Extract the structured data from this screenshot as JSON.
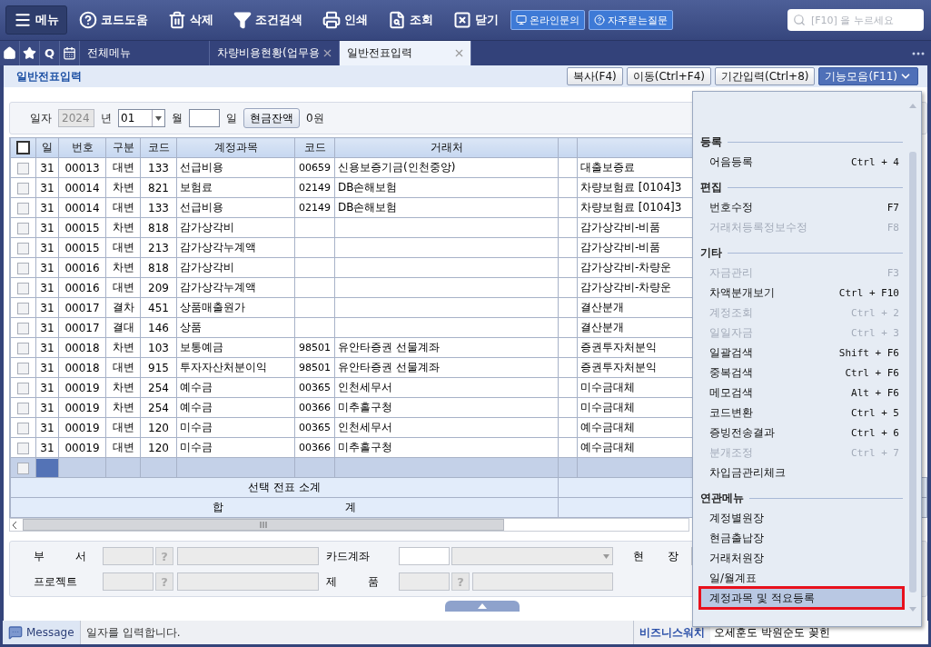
{
  "toolbar": {
    "buttons": [
      {
        "kind": "menu",
        "label": "메뉴"
      },
      {
        "kind": "help",
        "label": "코드도움"
      },
      {
        "kind": "delete",
        "label": "삭제"
      },
      {
        "kind": "filter",
        "label": "조건검색"
      },
      {
        "kind": "print",
        "label": "인쇄"
      },
      {
        "kind": "view",
        "label": "조회"
      },
      {
        "kind": "close",
        "label": "닫기"
      }
    ],
    "links": [
      {
        "kind": "monitor",
        "label": "온라인문의"
      },
      {
        "kind": "help",
        "label": "자주묻는질문"
      }
    ],
    "search": {
      "placeholder": "[F10] 을 누르세요"
    }
  },
  "tab_bar": {
    "quick": [
      {
        "kind": "home"
      },
      {
        "kind": "star"
      },
      {
        "kind": "text",
        "label": "Q"
      },
      {
        "kind": "calendar"
      }
    ],
    "tabs": [
      {
        "label": "전체메뉴",
        "selected": false,
        "closable": false
      },
      {
        "label": "차량비용현황(업무용",
        "selected": false,
        "closable": true
      },
      {
        "label": "일반전표입력",
        "selected": true,
        "closable": true
      }
    ]
  },
  "title_bar": {
    "title": "일반전표입력",
    "buttons": [
      {
        "label": "복사(F4)",
        "primary": false
      },
      {
        "label": "이동(Ctrl+F4)",
        "primary": false
      },
      {
        "label": "기간입력(Ctrl+8)",
        "primary": false
      },
      {
        "label": "기능모음(F11)",
        "primary": true
      }
    ]
  },
  "filter": {
    "date_label": "일자",
    "year": "2024",
    "year_unit": "년",
    "month": "01",
    "month_unit": "월",
    "day_unit": "일",
    "cash_button": "현금잔액",
    "cash_amount": "0원"
  },
  "table": {
    "header_checked": false,
    "columns": [
      "일",
      "번호",
      "구분",
      "코드",
      "계정과목",
      "코드",
      "거래처"
    ],
    "rows": [
      {
        "checked": false,
        "cells": [
          "31",
          "00013",
          "대변",
          "133",
          "선급비용",
          "00659",
          "신용보증기금(인천중앙)"
        ],
        "memo": "대출보증료"
      },
      {
        "checked": false,
        "cells": [
          "31",
          "00014",
          "차변",
          "821",
          "보험료",
          "02149",
          "DB손해보험"
        ],
        "memo": "차량보험료 [0104]3"
      },
      {
        "checked": false,
        "cells": [
          "31",
          "00014",
          "대변",
          "133",
          "선급비용",
          "02149",
          "DB손해보험"
        ],
        "memo": "차량보험료 [0104]3"
      },
      {
        "checked": false,
        "cells": [
          "31",
          "00015",
          "차변",
          "818",
          "감가상각비",
          "",
          ""
        ],
        "memo": "감가상각비-비품"
      },
      {
        "checked": false,
        "cells": [
          "31",
          "00015",
          "대변",
          "213",
          "감가상각누계액",
          "",
          ""
        ],
        "memo": "감가상각비-비품"
      },
      {
        "checked": false,
        "cells": [
          "31",
          "00016",
          "차변",
          "818",
          "감가상각비",
          "",
          ""
        ],
        "memo": "감가상각비-차량운"
      },
      {
        "checked": false,
        "cells": [
          "31",
          "00016",
          "대변",
          "209",
          "감가상각누계액",
          "",
          ""
        ],
        "memo": "감가상각비-차량운"
      },
      {
        "checked": false,
        "cells": [
          "31",
          "00017",
          "결차",
          "451",
          "상품매출원가",
          "",
          ""
        ],
        "memo": "결산분개"
      },
      {
        "checked": false,
        "cells": [
          "31",
          "00017",
          "결대",
          "146",
          "상품",
          "",
          ""
        ],
        "memo": "결산분개"
      },
      {
        "checked": false,
        "cells": [
          "31",
          "00018",
          "차변",
          "103",
          "보통예금",
          "98501",
          "유안타증권 선물계좌"
        ],
        "memo": "증권투자처분익"
      },
      {
        "checked": false,
        "cells": [
          "31",
          "00018",
          "대변",
          "915",
          "투자자산처분이익",
          "98501",
          "유안타증권 선물계좌"
        ],
        "memo": "증권투자처분익"
      },
      {
        "checked": false,
        "cells": [
          "31",
          "00019",
          "차변",
          "254",
          "예수금",
          "00365",
          "인천세무서"
        ],
        "memo": "미수금대체"
      },
      {
        "checked": false,
        "cells": [
          "31",
          "00019",
          "차변",
          "254",
          "예수금",
          "00366",
          "미추홀구청"
        ],
        "memo": "미수금대체"
      },
      {
        "checked": false,
        "cells": [
          "31",
          "00019",
          "대변",
          "120",
          "미수금",
          "00365",
          "인천세무서"
        ],
        "memo": "예수금대체"
      },
      {
        "checked": false,
        "cells": [
          "31",
          "00019",
          "대변",
          "120",
          "미수금",
          "00366",
          "미추홀구청"
        ],
        "memo": "예수금대체"
      }
    ],
    "entry_row": {
      "checked": false,
      "selected": true
    },
    "subtotal_label": "선택 전표 소계",
    "total_label": "합 계"
  },
  "detail_form": {
    "department": {
      "label": "부 서",
      "help": "?"
    },
    "project": {
      "label": "프로젝트",
      "help": "?"
    },
    "card_account": {
      "label": "카드계좌"
    },
    "product": {
      "label": "제 품",
      "help": "?"
    },
    "site": {
      "label": "현 장"
    }
  },
  "status_bar": {
    "message_label": "Message",
    "message": "일자를 입력합니다.",
    "news_source": "비즈니스워치",
    "news": "오세훈도 박원순도 꽂힌"
  },
  "function_menu": {
    "sections": [
      {
        "title": "등록",
        "items": [
          {
            "label": "어음등록",
            "shortcut": "Ctrl + 4",
            "disabled": false,
            "selected": false
          }
        ]
      },
      {
        "title": "편집",
        "items": [
          {
            "label": "번호수정",
            "shortcut": "F7",
            "disabled": false,
            "selected": false
          },
          {
            "label": "거래처등록정보수정",
            "shortcut": "F8",
            "disabled": true,
            "selected": false
          }
        ]
      },
      {
        "title": "기타",
        "items": [
          {
            "label": "자금관리",
            "shortcut": "F3",
            "disabled": true,
            "selected": false
          },
          {
            "label": "차액분개보기",
            "shortcut": "Ctrl + F10",
            "disabled": false,
            "selected": false
          },
          {
            "label": "계정조회",
            "shortcut": "Ctrl + 2",
            "disabled": true,
            "selected": false
          },
          {
            "label": "일일자금",
            "shortcut": "Ctrl + 3",
            "disabled": true,
            "selected": false
          },
          {
            "label": "일괄검색",
            "shortcut": "Shift + F6",
            "disabled": false,
            "selected": false
          },
          {
            "label": "중복검색",
            "shortcut": "Ctrl + F6",
            "disabled": false,
            "selected": false
          },
          {
            "label": "메모검색",
            "shortcut": "Alt + F6",
            "disabled": false,
            "selected": false
          },
          {
            "label": "코드변환",
            "shortcut": "Ctrl + 5",
            "disabled": false,
            "selected": false
          },
          {
            "label": "증빙전송결과",
            "shortcut": "Ctrl + 6",
            "disabled": false,
            "selected": false
          },
          {
            "label": "분개조정",
            "shortcut": "Ctrl + 7",
            "disabled": true,
            "selected": false
          },
          {
            "label": "차입금관리체크",
            "disabled": false,
            "selected": false
          }
        ]
      },
      {
        "title": "연관메뉴",
        "items": [
          {
            "label": "계정별원장",
            "disabled": false,
            "selected": false
          },
          {
            "label": "현금출납장",
            "disabled": false,
            "selected": false
          },
          {
            "label": "거래처원장",
            "disabled": false,
            "selected": false
          },
          {
            "label": "일/월계표",
            "disabled": false,
            "selected": false
          },
          {
            "label": "계정과목 및 적요등록",
            "disabled": false,
            "selected": true
          }
        ]
      }
    ]
  }
}
